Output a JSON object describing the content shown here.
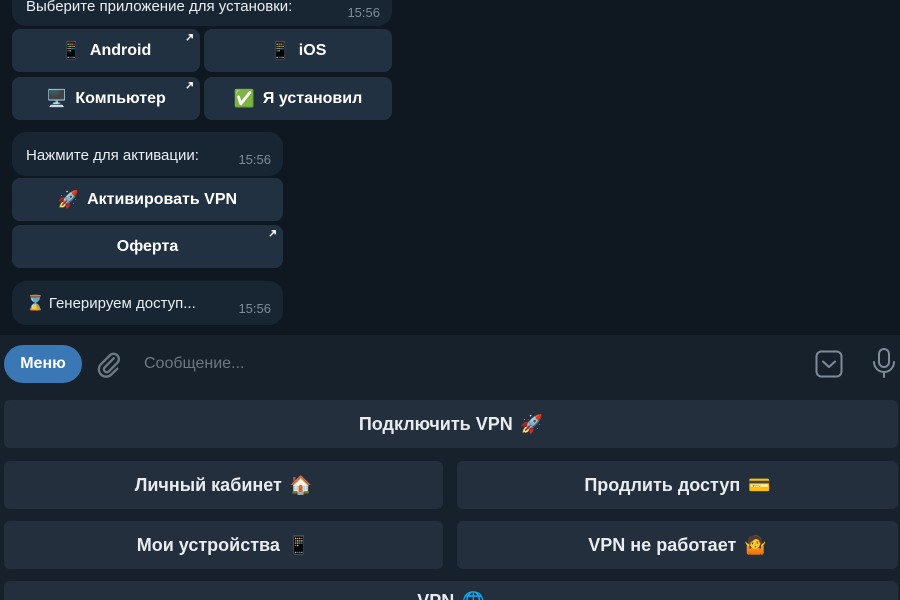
{
  "messages": [
    {
      "text": "Выберите приложение для установки:",
      "time": "15:56",
      "buttons": [
        {
          "icon": "📱",
          "label": "Android",
          "external": true
        },
        {
          "icon": "📱",
          "label": "iOS",
          "external": false
        },
        {
          "icon": "🖥️",
          "label": "Компьютер",
          "external": true
        },
        {
          "icon": "✅",
          "label": "Я установил",
          "external": false
        }
      ]
    },
    {
      "text": "Нажмите для активации:",
      "time": "15:56",
      "buttons": [
        {
          "icon": "🚀",
          "label": "Активировать VPN",
          "external": false
        },
        {
          "icon": "",
          "label": "Оферта",
          "external": true
        }
      ]
    },
    {
      "text": "⌛ Генерируем доступ...",
      "time": "15:56"
    }
  ],
  "input": {
    "menu_label": "Меню",
    "placeholder": "Сообщение..."
  },
  "keyboard": {
    "connect": {
      "label": "Подключить VPN",
      "emoji": "🚀"
    },
    "cabinet": {
      "label": "Личный кабинет",
      "emoji": "🏠"
    },
    "extend": {
      "label": "Продлить доступ",
      "emoji": "💳"
    },
    "devices": {
      "label": "Мои устройства",
      "emoji": "📱"
    },
    "broken": {
      "label": "VPN не работает",
      "emoji": "🤷"
    },
    "last": {
      "label": "VPN",
      "emoji": "🌐"
    }
  },
  "colors": {
    "chat_bg": "#0f1721",
    "bubble": "#182533",
    "panel": "#17212b",
    "accent": "#3a78b5",
    "button": "#242f3d"
  },
  "icons": [
    "paperclip-icon",
    "keyboard-toggle-icon",
    "microphone-icon",
    "external-link-icon"
  ]
}
